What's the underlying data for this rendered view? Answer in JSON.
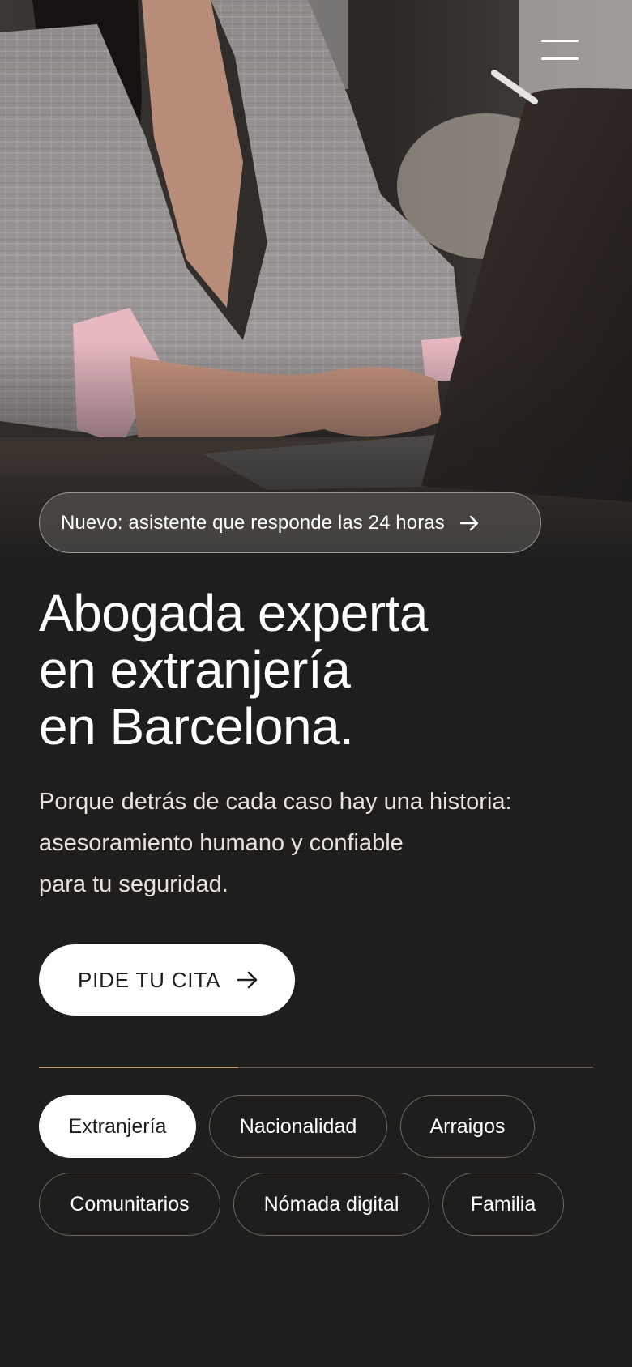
{
  "header": {
    "menu_icon": "hamburger-menu-icon"
  },
  "hero": {
    "photo_icon": "woman-typing-on-laptop-photo",
    "announcement": {
      "text": "Nuevo: asistente que responde las 24 horas",
      "icon": "arrow-right-icon"
    },
    "title_lines": [
      "Abogada experta",
      "en extranjería",
      "en Barcelona."
    ],
    "subtitle_lines": [
      "Porque detrás de cada caso hay una historia:",
      "asesoramiento humano y confiable",
      "para tu seguridad."
    ],
    "cta": {
      "label": "PIDE TU CITA",
      "icon": "arrow-right-icon"
    }
  },
  "services": {
    "progress": 0.36,
    "accent_color": "#b89a72",
    "tabs": [
      {
        "label": "Extranjería",
        "active": true
      },
      {
        "label": "Nacionalidad",
        "active": false
      },
      {
        "label": "Arraigos",
        "active": false
      },
      {
        "label": "Comunitarios",
        "active": false
      },
      {
        "label": "Nómada digital",
        "active": false
      },
      {
        "label": "Familia",
        "active": false
      }
    ]
  },
  "colors": {
    "background": "#1f1e1d",
    "text": "#ffffff",
    "button": "#ffffff"
  }
}
